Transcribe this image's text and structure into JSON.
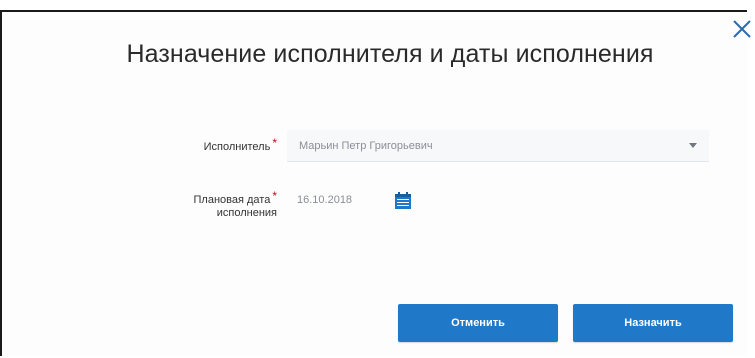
{
  "dialog": {
    "title": "Назначение исполнителя и даты исполнения",
    "close_icon": "close-icon"
  },
  "form": {
    "executor": {
      "label": "Исполнитель",
      "required_mark": "*",
      "value": "Марьин Петр Григорьевич"
    },
    "planned_date": {
      "label_line1": "Плановая дата",
      "label_line2": "исполнения",
      "required_mark": "*",
      "value": "16.10.2018",
      "icon": "calendar-icon"
    }
  },
  "buttons": {
    "cancel_label": "Отменить",
    "assign_label": "Назначить"
  },
  "colors": {
    "accent": "#1f78c8",
    "required": "#d0021b",
    "close_icon": "#2b6cb0"
  }
}
